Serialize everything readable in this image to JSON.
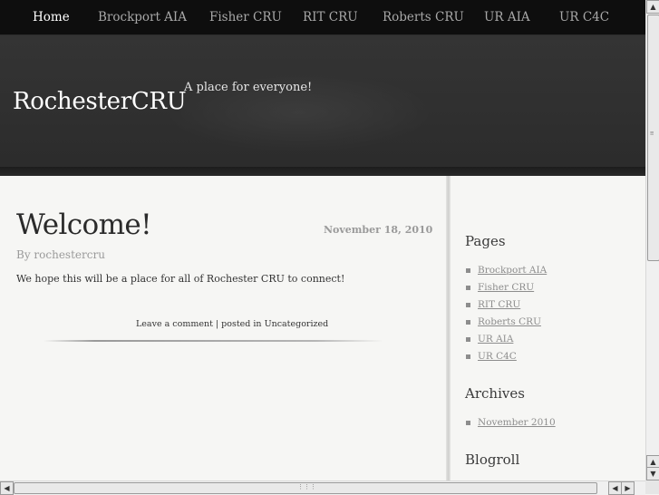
{
  "nav": {
    "items": [
      {
        "label": "Home",
        "active": true
      },
      {
        "label": "Brockport AIA",
        "active": false
      },
      {
        "label": "Fisher CRU",
        "active": false
      },
      {
        "label": "RIT CRU",
        "active": false
      },
      {
        "label": "Roberts CRU",
        "active": false
      },
      {
        "label": "UR AIA",
        "active": false
      },
      {
        "label": "UR C4C",
        "active": false
      }
    ]
  },
  "header": {
    "site_title": "RochesterCRU",
    "tagline": "A place for everyone!"
  },
  "post": {
    "title": "Welcome!",
    "date": "November 18, 2010",
    "author": "By rochestercru",
    "body": "We hope this will be a place for all of Rochester CRU to connect!",
    "comment_link": "Leave a comment",
    "separator": "|",
    "posted_in_prefix": "posted in",
    "category": "Uncategorized"
  },
  "sidebar": {
    "pages_title": "Pages",
    "pages": [
      "Brockport AIA",
      "Fisher CRU",
      "RIT CRU",
      "Roberts CRU",
      "UR AIA",
      "UR C4C"
    ],
    "archives_title": "Archives",
    "archives": [
      "November 2010"
    ],
    "blogroll_title": "Blogroll"
  },
  "scrollbar": {
    "up_arrow": "▲",
    "down_arrow": "▼",
    "left_arrow": "◀",
    "right_arrow": "▶"
  },
  "colors": {
    "nav_bg": "#0e0e0e",
    "header_bg": "#2f2f2f",
    "content_bg": "#f6f6f4",
    "link_gray": "#8d8d8d"
  }
}
